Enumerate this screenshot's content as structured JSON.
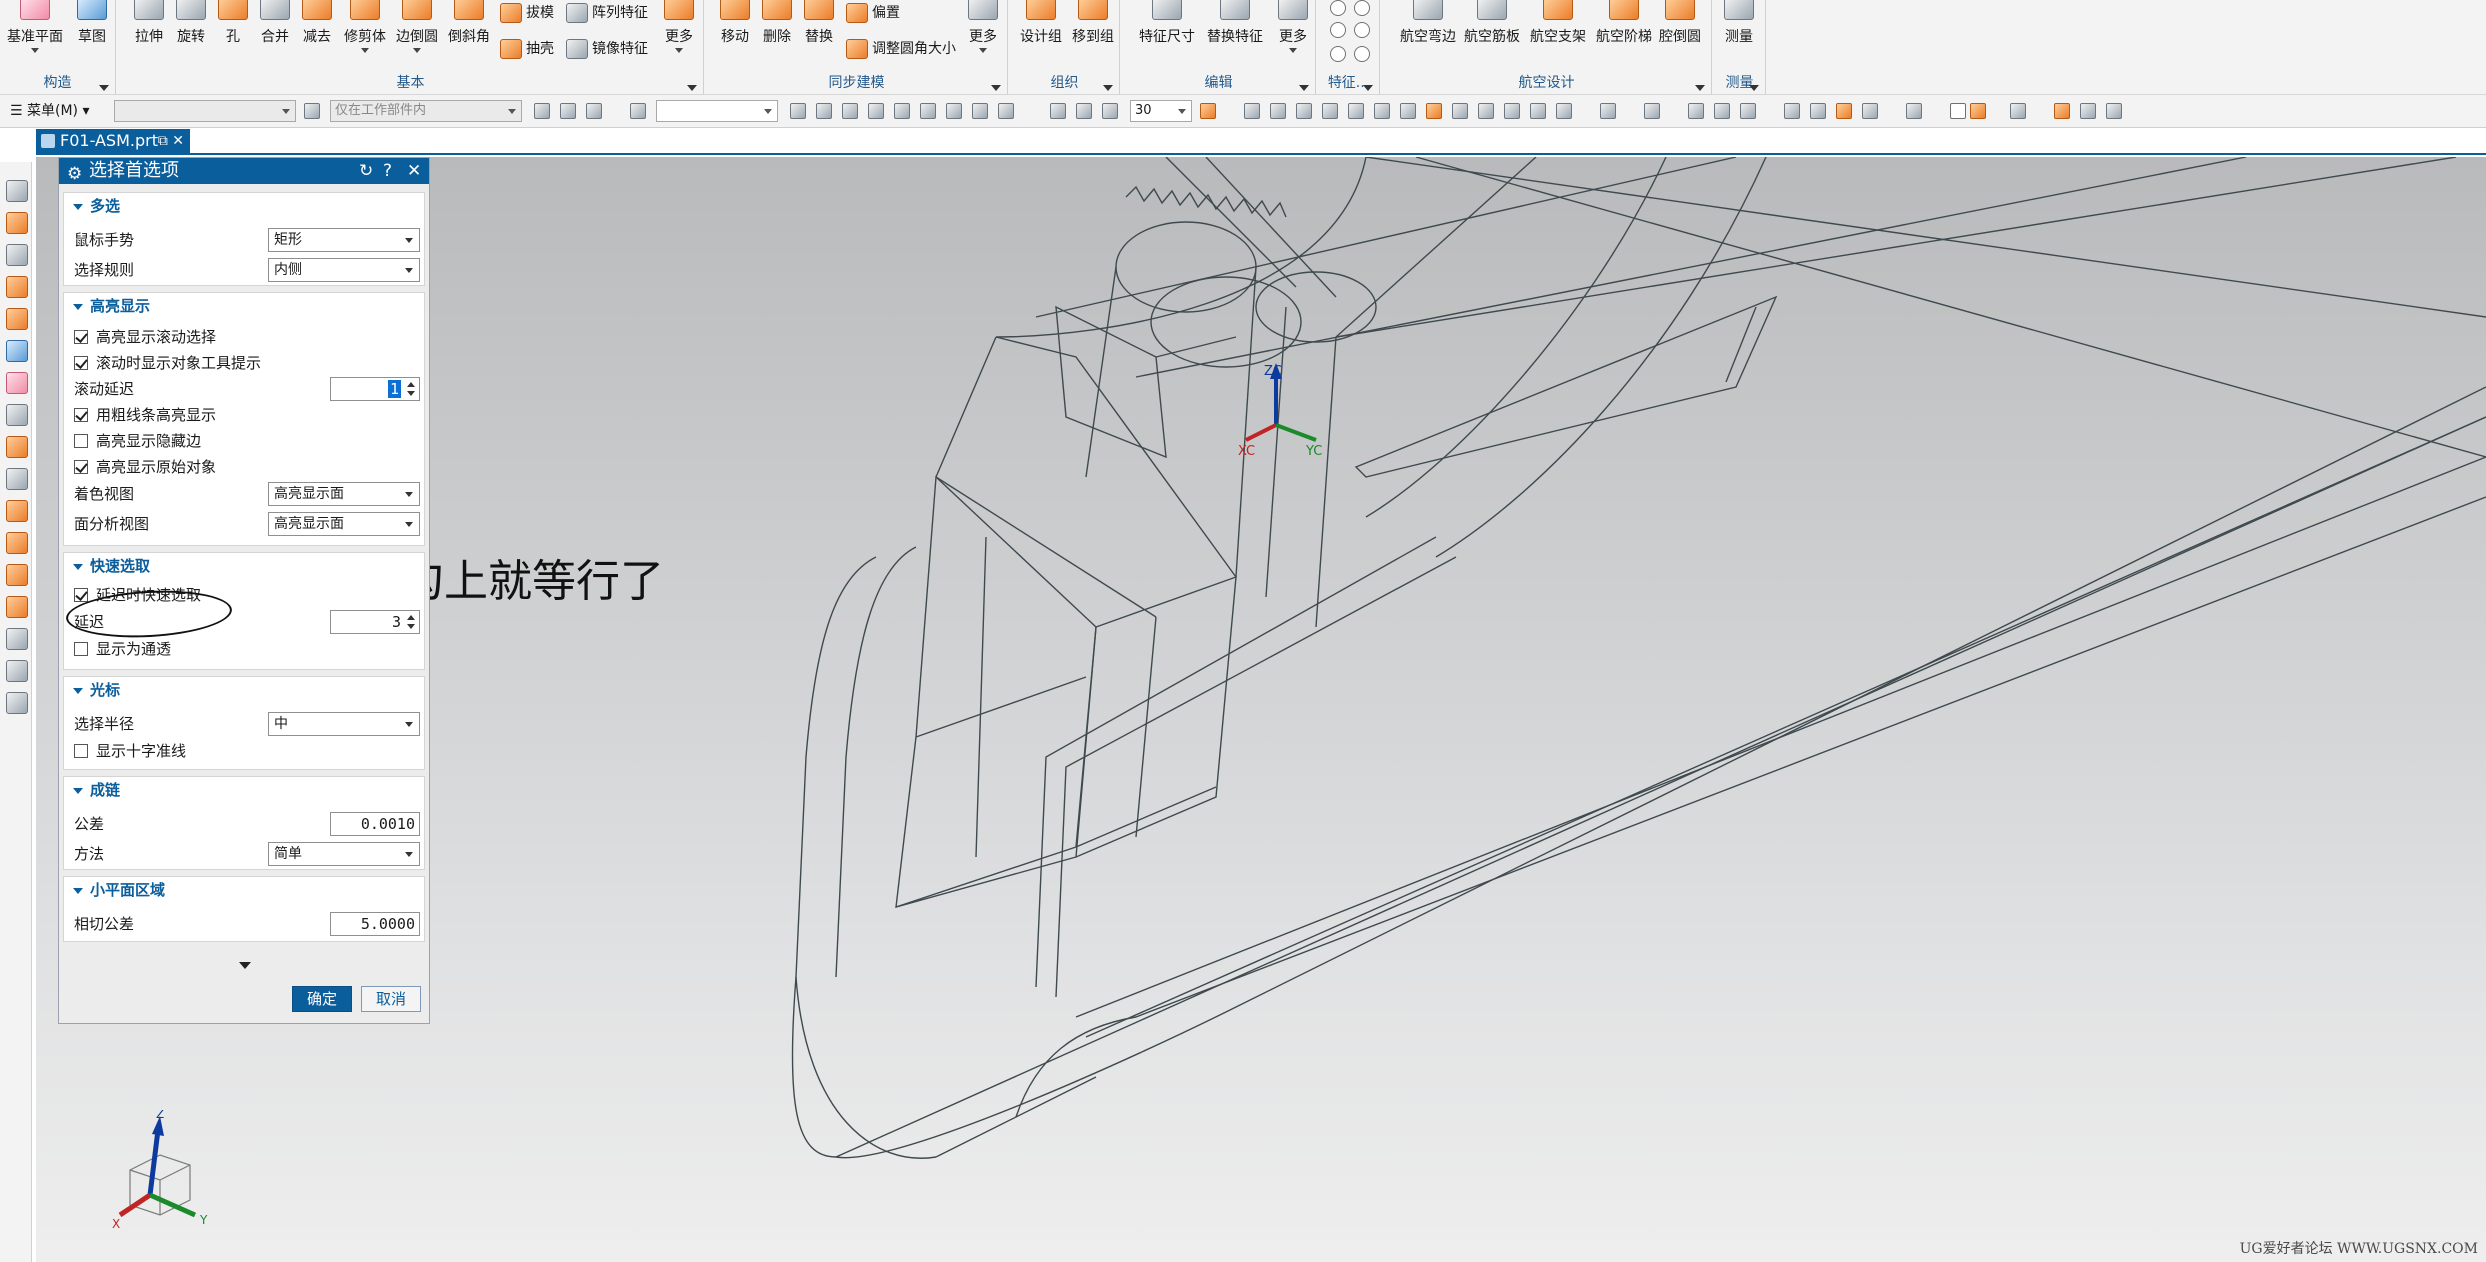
{
  "ribbon": {
    "groups": [
      {
        "label": "构造",
        "buttons": [
          "基准平面",
          "草图"
        ]
      },
      {
        "label": "基本",
        "buttons": [
          "拉伸",
          "旋转",
          "孔",
          "合并",
          "减去",
          "修剪体",
          "边倒圆",
          "倒斜角",
          "更多"
        ],
        "small_buttons": [
          "拔模",
          "抽壳",
          "阵列特征",
          "镜像特征"
        ]
      },
      {
        "label": "同步建模",
        "buttons": [
          "移动",
          "删除",
          "替换",
          "更多"
        ],
        "small_buttons": [
          "偏置",
          "调整圆角大小"
        ]
      },
      {
        "label": "组织",
        "buttons": [
          "设计组",
          "移到组"
        ]
      },
      {
        "label": "编辑",
        "buttons": [
          "特征尺寸",
          "替换特征",
          "更多"
        ]
      },
      {
        "label": "特征...",
        "buttons": []
      },
      {
        "label": "航空设计",
        "buttons": [
          "航空弯边",
          "航空筋板",
          "航空支架",
          "航空阶梯",
          "腔倒圆"
        ]
      },
      {
        "label": "测量",
        "buttons": [
          "测量"
        ]
      }
    ]
  },
  "toolbar2": {
    "menu_label": "菜单(M)",
    "filter_placeholder": "仅在工作部件内",
    "angle_value": "30"
  },
  "file_tab": {
    "name": "F01-ASM.prt"
  },
  "dialog": {
    "title": "选择首选项",
    "sections": {
      "multi": {
        "title": "多选",
        "mouse_gesture_label": "鼠标手势",
        "mouse_gesture_value": "矩形",
        "select_rule_label": "选择规则",
        "select_rule_value": "内侧"
      },
      "highlight": {
        "title": "高亮显示",
        "cb1": "高亮显示滚动选择",
        "cb1_checked": true,
        "cb2": "滚动时显示对象工具提示",
        "cb2_checked": true,
        "delay_label": "滚动延迟",
        "delay_value": "1",
        "cb3": "用粗线条高亮显示",
        "cb3_checked": true,
        "cb4": "高亮显示隐藏边",
        "cb4_checked": false,
        "cb5": "高亮显示原始对象",
        "cb5_checked": true,
        "shaded_label": "着色视图",
        "shaded_value": "高亮显示面",
        "face_label": "面分析视图",
        "face_value": "高亮显示面"
      },
      "quick": {
        "title": "快速选取",
        "cb1": "延迟时快速选取",
        "cb1_checked": true,
        "delay_label": "延迟",
        "delay_value": "3",
        "cb2": "显示为通透",
        "cb2_checked": false
      },
      "cursor": {
        "title": "光标",
        "radius_label": "选择半径",
        "radius_value": "中",
        "cb1": "显示十字准线",
        "cb1_checked": false
      },
      "chain": {
        "title": "成链",
        "tol_label": "公差",
        "tol_value": "0.0010",
        "method_label": "方法",
        "method_value": "简单"
      },
      "facet": {
        "title": "小平面区域",
        "tangent_label": "相切公差",
        "tangent_value": "5.0000"
      }
    },
    "ok_label": "确定",
    "cancel_label": "取消"
  },
  "annotation": "把这个勾上就等行了",
  "viewport": {
    "wcs_labels": {
      "z": "ZC",
      "x": "XC",
      "y": "YC"
    },
    "triad_labels": {
      "z": "Z",
      "x": "X",
      "y": "Y"
    },
    "watermark": "UG爱好者论坛 WWW.UGSNX.COM"
  },
  "colors": {
    "accent": "#0b5e9c",
    "ribbon_bg": "#f3f3f3",
    "dialog_bg": "#ececec"
  }
}
